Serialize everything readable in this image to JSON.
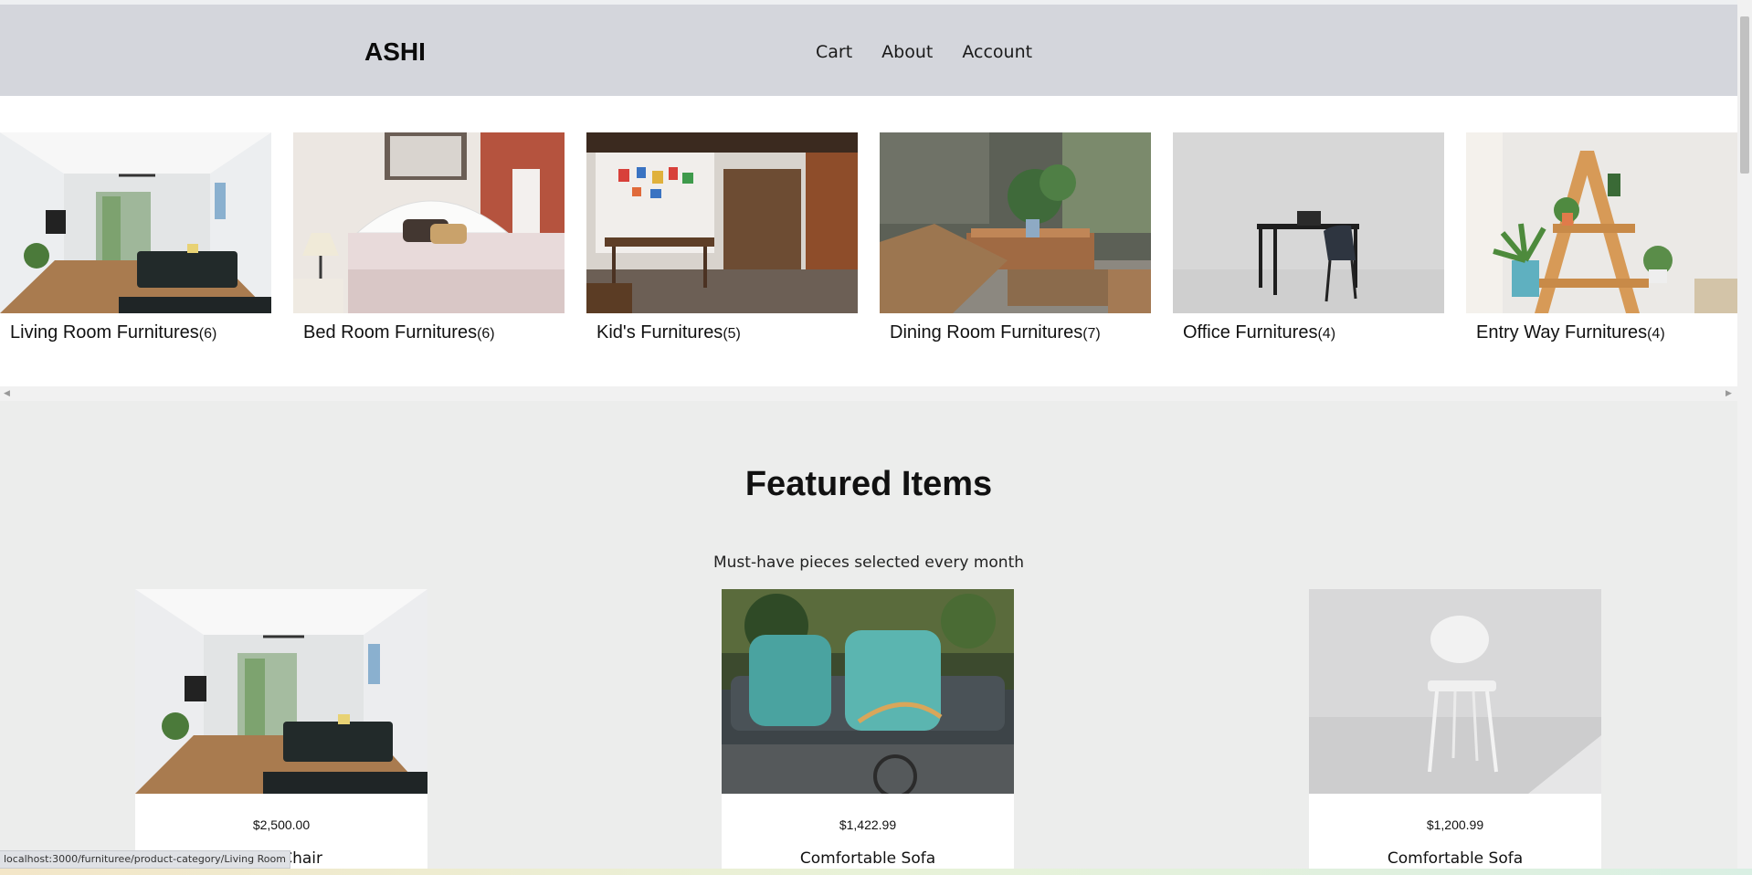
{
  "header": {
    "brand": "ASHI",
    "nav": [
      {
        "label": "Cart"
      },
      {
        "label": "About"
      },
      {
        "label": "Account"
      }
    ]
  },
  "categories": [
    {
      "name": "Living Room Furnitures",
      "count": "(6)",
      "image": "living-room-photo"
    },
    {
      "name": "Bed Room Furnitures",
      "count": "(6)",
      "image": "bedroom-photo"
    },
    {
      "name": "Kid's Furnitures",
      "count": "(5)",
      "image": "kids-room-photo"
    },
    {
      "name": "Dining Room Furnitures",
      "count": "(7)",
      "image": "dining-patio-photo"
    },
    {
      "name": "Office Furnitures",
      "count": "(4)",
      "image": "office-desk-photo"
    },
    {
      "name": "Entry Way Furnitures",
      "count": "(4)",
      "image": "entryway-plants-photo"
    }
  ],
  "featured": {
    "title": "Featured Items",
    "subtitle": "Must-have pieces selected every month",
    "products": [
      {
        "price": "$2,500.00",
        "name": "Chair",
        "image": "living-room-photo"
      },
      {
        "price": "$1,422.99",
        "name": "Comfortable Sofa",
        "image": "sofa-cushions-photo"
      },
      {
        "price": "$1,200.99",
        "name": "Comfortable Sofa",
        "image": "white-chair-photo"
      }
    ]
  },
  "status_url": "localhost:3000/furnituree/product-category/Living Room",
  "colors": {
    "header_bg": "#d4d6dc",
    "featured_bg": "#ecedec",
    "card_bg": "#ffffff"
  }
}
